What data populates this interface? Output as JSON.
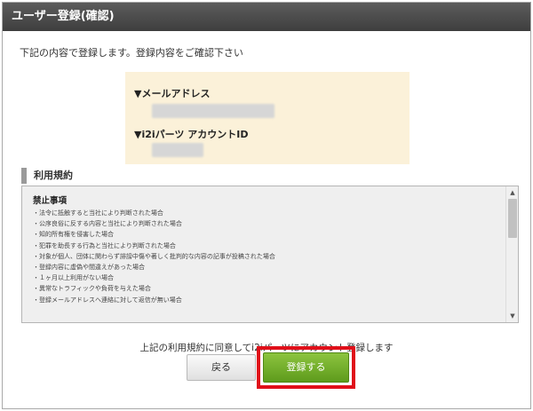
{
  "header": {
    "title": "ユーザー登録(確認)"
  },
  "intro": "下記の内容で登録します。登録内容をご確認下さい",
  "info": {
    "email_label": "▼メールアドレス",
    "account_label": "▼i2iパーツ アカウントID"
  },
  "terms": {
    "section_title": "利用規約",
    "heading": "禁止事項",
    "items": [
      "・法令に抵触すると当社により判断された場合",
      "・公序良俗に反する内容と当社により判断された場合",
      "・知的所有権を侵害した場合",
      "・犯罪を助長する行為と当社により判断された場合",
      "・対象が個人、団体に関わらず誹謗中傷や著しく批判的な内容の記事が投稿された場合",
      "・登録内容に虚偽や間違えがあった場合",
      "・１ヶ月以上利用がない場合",
      "・異常なトラフィックや負荷を与えた場合",
      "・登録メールアドレスへ連絡に対して返信が無い場合"
    ]
  },
  "agree_text": "上記の利用規約に同意してi2iパーツにアカウント登録します",
  "buttons": {
    "back": "戻る",
    "register": "登録する"
  },
  "colors": {
    "header_bg": "#3e3e3e",
    "info_bg": "#fbf1d9",
    "register_green": "#6aaa28",
    "highlight_red": "#e0101a"
  }
}
